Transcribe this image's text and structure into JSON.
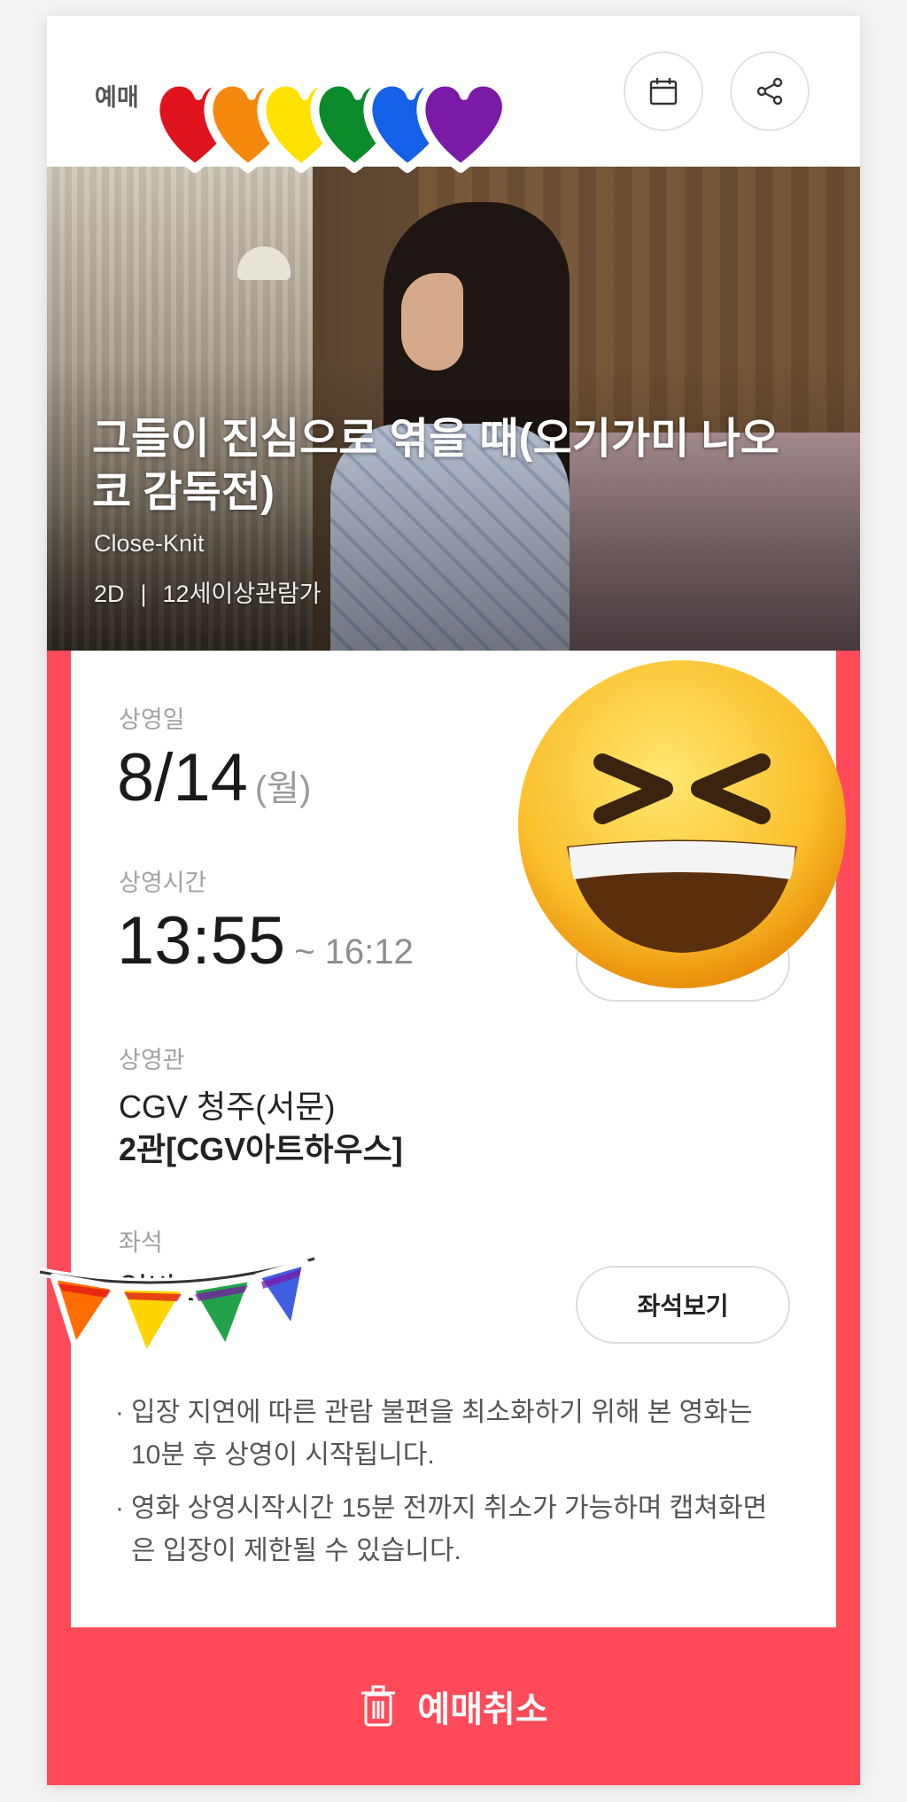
{
  "header": {
    "label": "예매",
    "calendar_icon": "calendar-icon",
    "share_icon": "share-icon"
  },
  "movie": {
    "title": "그들이 진심으로 엮을 때(오기가미 나오코 감독전)",
    "subtitle": "Close-Knit",
    "format": "2D",
    "separator": "|",
    "rating": "12세이상관람가"
  },
  "details": {
    "date_label": "상영일",
    "date": "8/14",
    "weekday": "(월)",
    "time_label": "상영시간",
    "start_time": "13:55",
    "end_time": "~ 16:12",
    "theater_label": "상영관",
    "theater_name": "CGV 청주(서문)",
    "hall": "2관[CGV아트하우스]",
    "seat_label": "좌석",
    "seat_value": "일반 1",
    "seat_button": "좌석보기"
  },
  "notes": [
    "입장 지연에 따른 관람 불편을 최소화하기 위해 본 영화는 10분 후 상영이 시작됩니다.",
    "영화 상영시작시간 15분 전까지 취소가 가능하며 캡쳐화면은 입장이 제한될 수 있습니다."
  ],
  "footer": {
    "cancel_label": "예매취소",
    "trash_icon": "trash-icon"
  },
  "colors": {
    "accent": "#ff4a5a",
    "text": "#222222",
    "muted": "#a2a2a2"
  },
  "stickers": [
    "rainbow-hearts-sticker",
    "laughing-emoji-sticker",
    "rainbow-bunting-sticker"
  ]
}
